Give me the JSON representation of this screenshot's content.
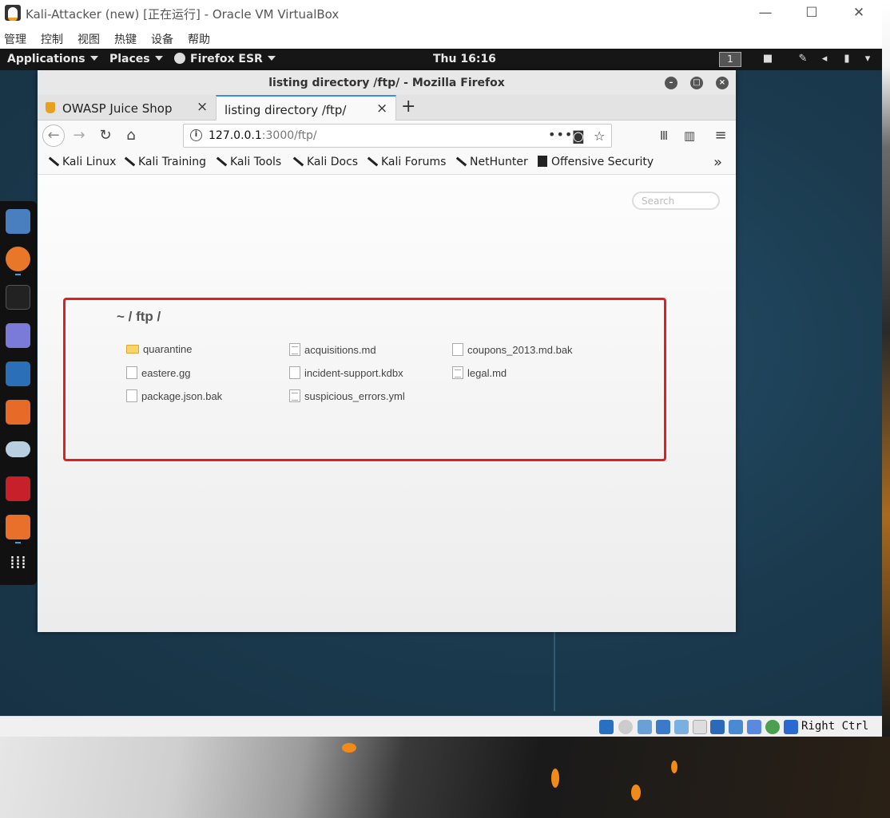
{
  "vbox": {
    "title": "Kali-Attacker (new) [正在运行] - Oracle VM VirtualBox",
    "menu": [
      "管理",
      "控制",
      "视图",
      "热键",
      "设备",
      "帮助"
    ],
    "host_key": "Right Ctrl"
  },
  "gnome": {
    "applications": "Applications",
    "places": "Places",
    "firefox": "Firefox ESR",
    "clock": "Thu 16:16",
    "workspace": "1"
  },
  "firefox": {
    "window_title": "listing directory /ftp/ - Mozilla Firefox",
    "tabs": [
      {
        "label": "OWASP Juice Shop",
        "active": false
      },
      {
        "label": "listing directory /ftp/",
        "active": true
      }
    ],
    "url": {
      "host": "127.0.0.1",
      "path": ":3000/ftp/"
    },
    "bookmarks": [
      "Kali Linux",
      "Kali Training",
      "Kali Tools",
      "Kali Docs",
      "Kali Forums",
      "NetHunter",
      "Offensive Security"
    ]
  },
  "page": {
    "search_placeholder": "Search",
    "title": "~ / ftp /",
    "files": [
      {
        "name": "quarantine",
        "type": "folder"
      },
      {
        "name": "acquisitions.md",
        "type": "text"
      },
      {
        "name": "coupons_2013.md.bak",
        "type": "file"
      },
      {
        "name": "eastere.gg",
        "type": "file"
      },
      {
        "name": "incident-support.kdbx",
        "type": "file"
      },
      {
        "name": "legal.md",
        "type": "text"
      },
      {
        "name": "package.json.bak",
        "type": "file"
      },
      {
        "name": "suspicious_errors.yml",
        "type": "text"
      }
    ]
  },
  "colors": {
    "highlight": "#e02020",
    "tab_accent": "#3a8ee6",
    "desktop": "#1c3c4f"
  }
}
